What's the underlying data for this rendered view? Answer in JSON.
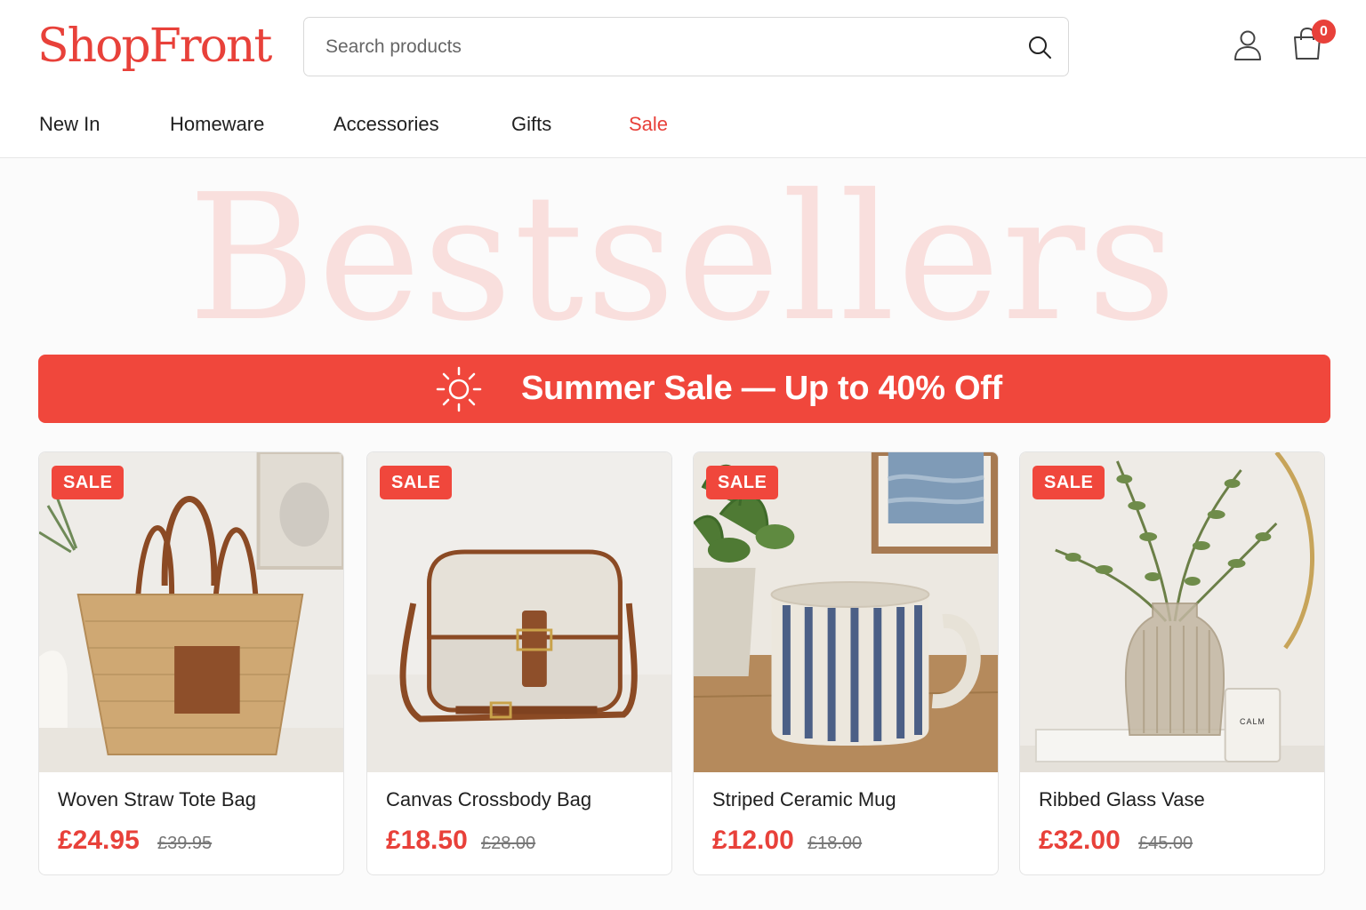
{
  "header": {
    "logo": "ShopFront",
    "search": {
      "placeholder": "Search products",
      "value": ""
    },
    "cart_count": "0"
  },
  "nav": [
    "New In",
    "Homeware",
    "Accessories",
    "Gifts",
    "Sale"
  ],
  "hero": {
    "title": "Bestsellers"
  },
  "banner": {
    "text": "Summer Sale — Up to 40% Off",
    "icon": "sun-icon"
  },
  "products": [
    {
      "badge": "SALE",
      "name": "Woven Straw Tote Bag",
      "price": "£24.95",
      "old_price": "£39.95"
    },
    {
      "badge": "SALE",
      "name": "Canvas Crossbody Bag",
      "price": "£18.50",
      "old_price": "£28.00"
    },
    {
      "badge": "SALE",
      "name": "Striped Ceramic Mug",
      "price": "£12.00",
      "old_price": "£18.00"
    },
    {
      "badge": "SALE",
      "name": "Ribbed Glass Vase",
      "price": "£32.00",
      "old_price": "£45.00",
      "candle_label": "CALM"
    }
  ],
  "colors": {
    "accent": "#e8413a",
    "banner": "#f0473c",
    "hero_text": "#f9dfdd"
  }
}
